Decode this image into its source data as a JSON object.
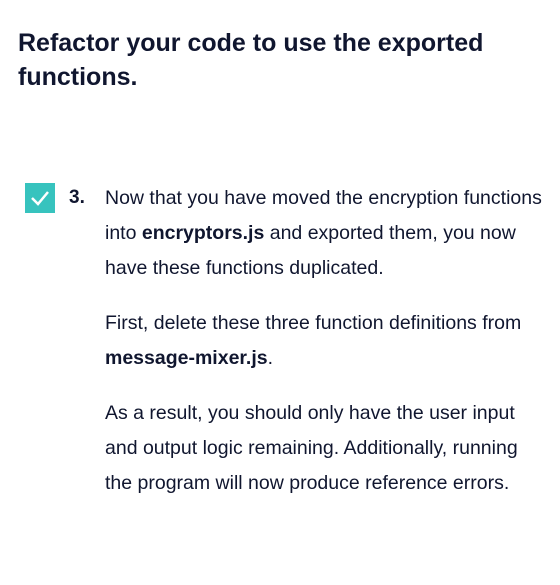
{
  "heading": "Refactor your code to use the exported functions.",
  "task": {
    "number": "3.",
    "checked": true,
    "check_color": "#37c3be",
    "paragraphs": [
      {
        "a": "Now that you have moved the encryption functions into ",
        "b": "encryptors.js",
        "c": " and exported them, you now have these functions duplicated."
      },
      {
        "a": "First, delete these three function definitions from ",
        "b": "message-mixer.js",
        "c": "."
      },
      {
        "a": "As a result, you should only have the user input and output logic remaining. Additionally, running the program will now produce reference errors.",
        "b": "",
        "c": ""
      }
    ]
  }
}
